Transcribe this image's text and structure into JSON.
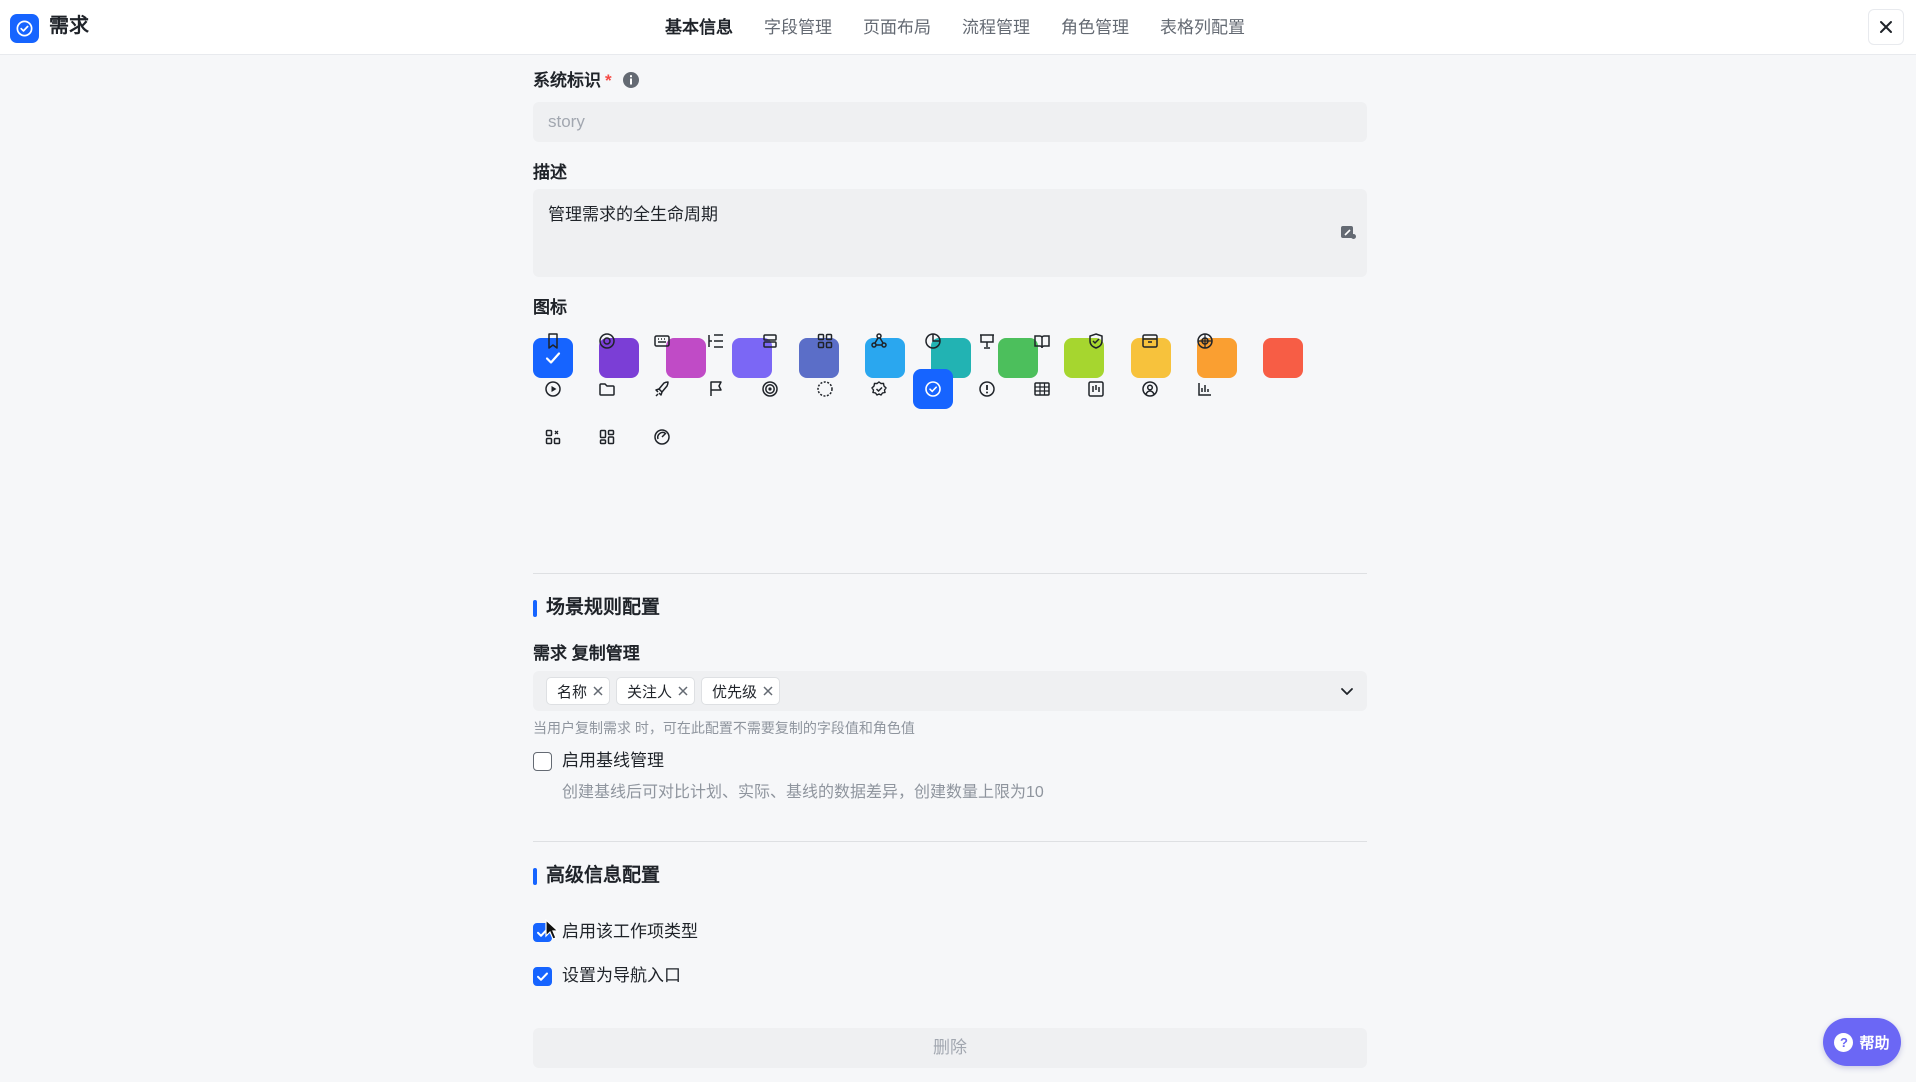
{
  "header": {
    "app_title": "需求",
    "tabs": [
      {
        "label": "基本信息",
        "active": true
      },
      {
        "label": "字段管理",
        "active": false
      },
      {
        "label": "页面布局",
        "active": false
      },
      {
        "label": "流程管理",
        "active": false
      },
      {
        "label": "角色管理",
        "active": false
      },
      {
        "label": "表格列配置",
        "active": false
      }
    ],
    "close_icon": "close-icon"
  },
  "form": {
    "system_id": {
      "label": "系统标识",
      "required_mark": "*",
      "placeholder": "story"
    },
    "description": {
      "label": "描述",
      "value": "管理需求的全生命周期"
    },
    "icon": {
      "label": "图标",
      "colors": [
        "#1664ff",
        "#7b3ed6",
        "#c04bc6",
        "#7b67f5",
        "#5b6ec8",
        "#2aa7ef",
        "#22b3b3",
        "#4cbf5c",
        "#a6d62f",
        "#f7c23c",
        "#fa9f31",
        "#f75d45"
      ],
      "selected_color_index": 0,
      "icons": [
        "bookmark-icon",
        "smile-icon",
        "keyboard-icon",
        "list-indent-icon",
        "server-icon",
        "grid-icon",
        "triangle-nodes-icon",
        "pie-chart-icon",
        "presentation-icon",
        "book-icon",
        "shield-icon",
        "archive-icon",
        "target-grid-icon",
        "play-icon",
        "folder-icon",
        "rocket-icon",
        "flag-icon",
        "target-icon",
        "ball-icon",
        "badge-check-icon",
        "check-circle-icon",
        "alert-circle-icon",
        "table-icon",
        "columns-icon",
        "user-circle-icon",
        "bar-chart-icon",
        "apps-icon",
        "layout-icon",
        "speed-icon"
      ],
      "selected_icon_index": 20
    }
  },
  "scene_rules": {
    "title": "场景规则配置",
    "copy_management": {
      "label": "需求 复制管理",
      "tags": [
        "名称",
        "关注人",
        "优先级"
      ],
      "hint": "当用户复制需求 时，可在此配置不需要复制的字段值和角色值"
    },
    "baseline": {
      "label": "启用基线管理",
      "checked": false,
      "description": "创建基线后可对比计划、实际、基线的数据差异，创建数量上限为10"
    }
  },
  "advanced": {
    "title": "高级信息配置",
    "enable_type": {
      "label": "启用该工作项类型",
      "checked": true
    },
    "nav_entry": {
      "label": "设置为导航入口",
      "checked": true
    }
  },
  "delete_label": "删除",
  "help_label": "帮助",
  "colors": {
    "accent": "#1664ff",
    "help": "#6b67f5"
  }
}
